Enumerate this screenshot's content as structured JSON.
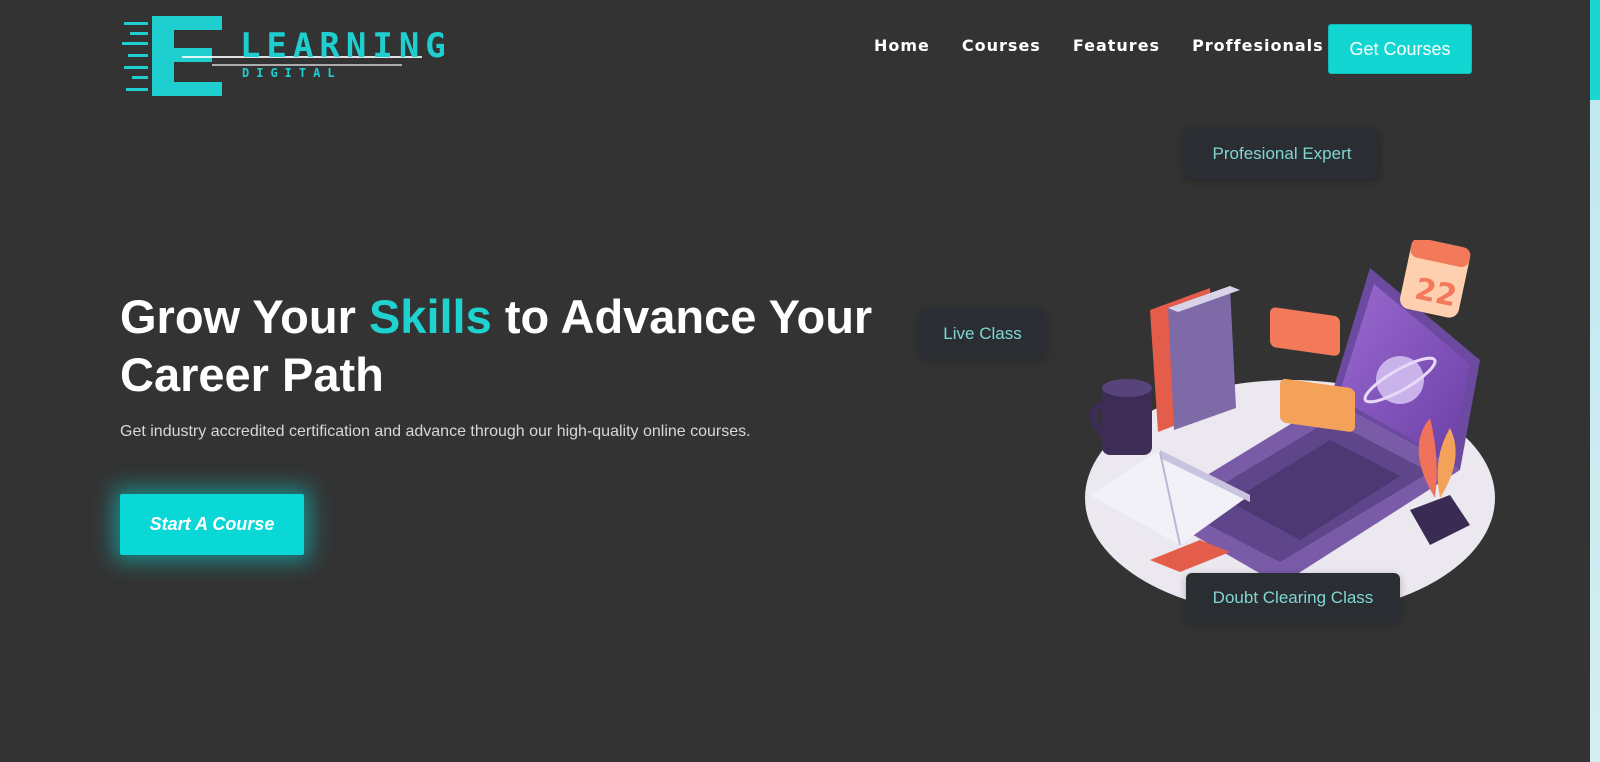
{
  "logo": {
    "word": "LEARNING",
    "sub": "DIGITAL",
    "letter": "E"
  },
  "nav": {
    "items": [
      {
        "label": "Home"
      },
      {
        "label": "Courses"
      },
      {
        "label": "Features"
      },
      {
        "label": "Proffesionals"
      }
    ],
    "cta_label": "Get Courses"
  },
  "hero": {
    "title_part1": "Grow Your ",
    "title_accent": "Skills",
    "title_part2": " to Advance Your Career Path",
    "subtitle": "Get industry accredited certification and advance through our high-quality online courses.",
    "button_label": "Start A Course"
  },
  "badges": {
    "expert": "Profesional Expert",
    "live": "Live Class",
    "doubt": "Doubt Clearing Class"
  },
  "calendar_day": "22",
  "colors": {
    "accent": "#12d6d1",
    "background": "#333333",
    "badge_text": "#7fd6d3"
  }
}
